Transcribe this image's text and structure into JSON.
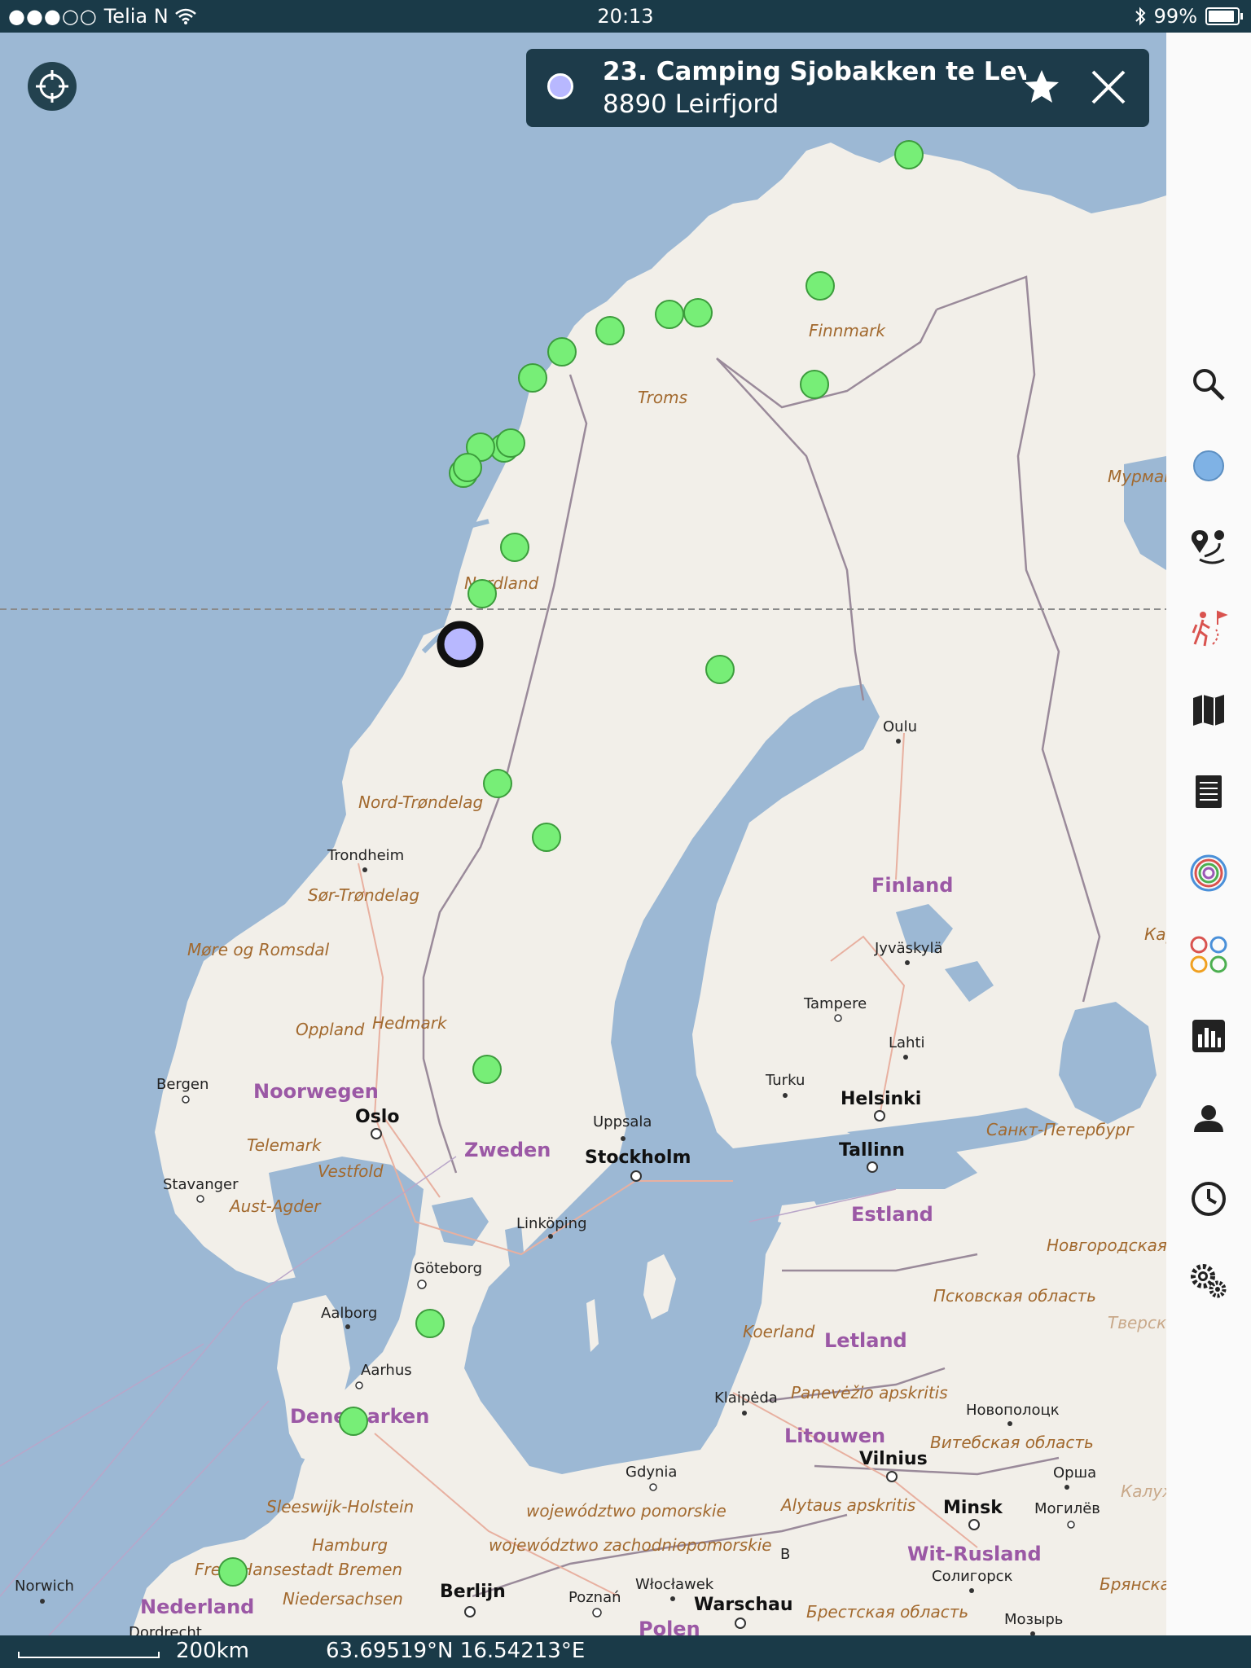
{
  "status_bar": {
    "carrier": "Telia N",
    "time": "20:13",
    "battery": "99%"
  },
  "info_panel": {
    "title": "23. Camping Sjobakken te Lev...",
    "subtitle": "8890 Leirfjord"
  },
  "bottom_bar": {
    "scale": "200km",
    "coordinates": "63.69519°N 16.54213°E"
  },
  "sidebar": {
    "tools": [
      "search-icon",
      "blue-dot-icon",
      "pin-route-icon",
      "hiking-icon",
      "map-icon",
      "list-icon",
      "rings-icon",
      "circles-icon",
      "chart-icon",
      "user-icon",
      "clock-icon",
      "gears-icon"
    ]
  },
  "map": {
    "labels": {
      "finnmark": "Finnmark",
      "troms": "Troms",
      "nordland": "Nordland",
      "nord_trondelag": "Nord-Trøndelag",
      "trondheim": "Trondheim",
      "sor_trondelag": "Sør-Trøndelag",
      "more_og_romsdal": "Møre og Romsdal",
      "oppland": "Oppland",
      "hedmark": "Hedmark",
      "bergen": "Bergen",
      "noorwegen": "Noorwegen",
      "oslo": "Oslo",
      "telemark": "Telemark",
      "vestfold": "Vestfold",
      "stavanger": "Stavanger",
      "aust_agder": "Aust-Agder",
      "zweden": "Zweden",
      "uppsala": "Uppsala",
      "stockholm": "Stockholm",
      "linkoping": "Linköping",
      "goteborg": "Göteborg",
      "aalborg": "Aalborg",
      "aarhus": "Aarhus",
      "denemarken": "Denemarken",
      "sleeswijk_holstein": "Sleeswijk-Holstein",
      "hamburg": "Hamburg",
      "freie_hansestadt_bremen": "Freie Hansestadt Bremen",
      "niedersachsen": "Niedersachsen",
      "nederland": "Nederland",
      "norwich": "Norwich",
      "dordrecht": "Dordrecht",
      "berlijn": "Berlijn",
      "poznan": "Poznań",
      "polen": "Polen",
      "wloclawek": "Włocławek",
      "warschau": "Warschau",
      "gdynia": "Gdynia",
      "woj_pomorskie": "województwo pomorskie",
      "woj_zachodniopomorskie": "województwo zachodniopomorskie",
      "klaipeda": "Klaipėda",
      "koerland": "Koerland",
      "letland": "Letland",
      "panevezio": "Panevėžio apskritis",
      "litouwen": "Litouwen",
      "vilnius": "Vilnius",
      "alytaus": "Alytaus apskritis",
      "minsk": "Minsk",
      "wit_rusland": "Wit-Rusland",
      "novopolotsk": "Новополоцк",
      "vitebsk": "Витебская область",
      "orsha": "Орша",
      "mogilev": "Могилёв",
      "soligorsk": "Солигорск",
      "brest": "Брестская область",
      "mozyr": "Мозырь",
      "bryansk": "Брянская област",
      "kaluzhskaya": "Калужская",
      "tverskaya": "Тверская",
      "novgorod": "Новгородская область",
      "pskov": "Псковская область",
      "estland": "Estland",
      "tallinn": "Tallinn",
      "helsinki": "Helsinki",
      "turku": "Turku",
      "lahti": "Lahti",
      "tampere": "Tampere",
      "jyvaskyla": "Jyväskylä",
      "finland": "Finland",
      "oulu": "Oulu",
      "karelia": "Карелия",
      "murmansk": "Мурманская обл",
      "spb": "Санкт-Петербург",
      "b": "B"
    },
    "markers_visited_count": 22,
    "selected_marker": "23. Camping Sjobakken te Lev...",
    "colors": {
      "water": "#9cb8d4",
      "land": "#f2efe9",
      "marker_green": "#77ee77",
      "marker_selected": "#b8b8ff"
    }
  }
}
